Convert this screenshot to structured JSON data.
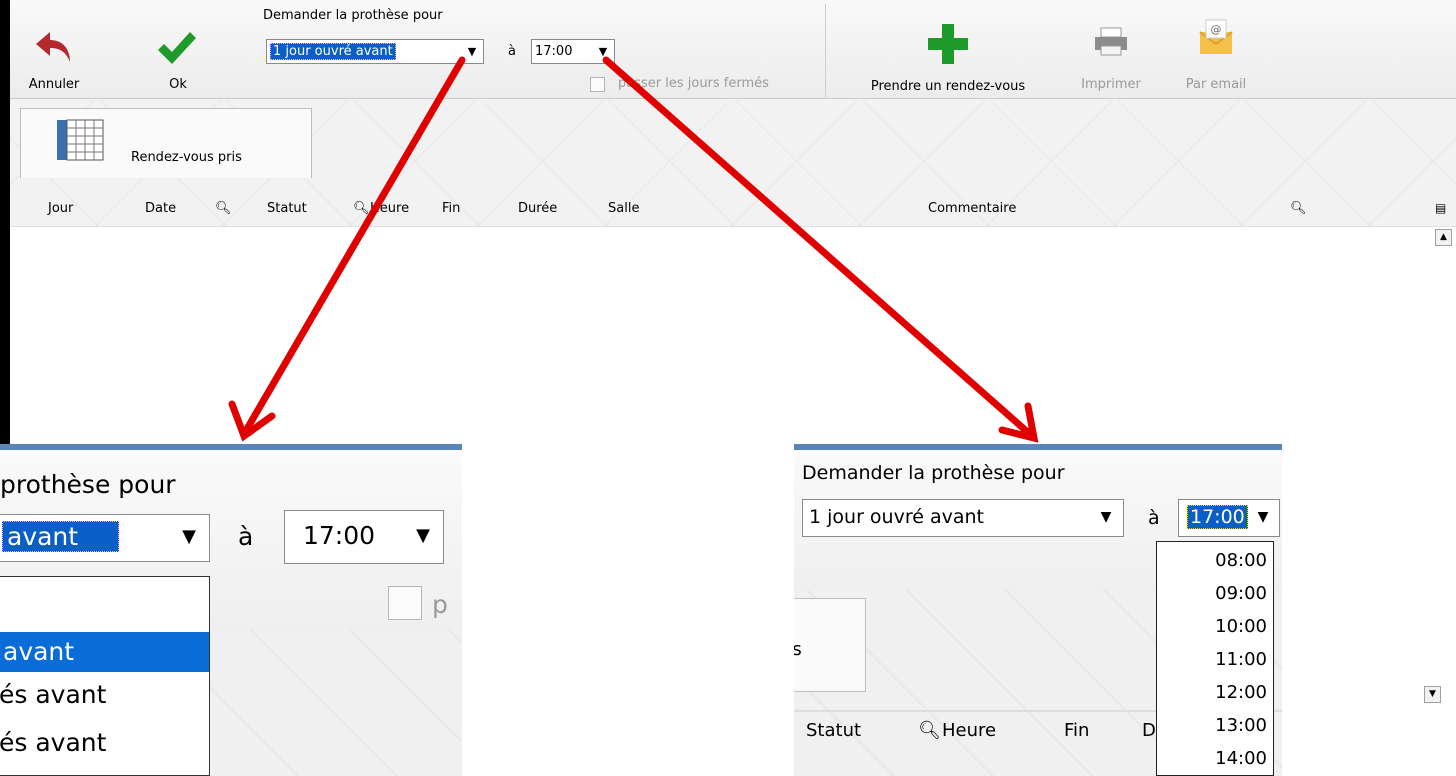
{
  "toolbar": {
    "cancel_label": "Annuler",
    "ok_label": "Ok",
    "request_label": "Demander la prothèse pour",
    "delay_value": "1 jour ouvré avant",
    "at_label": "à",
    "time_value": "17:00",
    "skip_closed_label": "passer les jours fermés",
    "appointment_label": "Prendre un rendez-vous",
    "print_label": "Imprimer",
    "email_label": "Par email"
  },
  "tab": {
    "label": "Rendez-vous pris"
  },
  "table": {
    "columns": [
      "Jour",
      "Date",
      "Statut",
      "Heure",
      "Fin",
      "Durée",
      "Salle",
      "Commentaire"
    ]
  },
  "zoom_left": {
    "heading": "prothèse pour",
    "combo_value": "avant",
    "at_label": "à",
    "time_value": "17:00",
    "skip_partial": "p",
    "options": [
      "",
      "avant",
      "és avant",
      "és avant"
    ],
    "selected_index": 1
  },
  "zoom_right": {
    "heading": "Demander la prothèse pour",
    "combo_value": "1 jour ouvré avant",
    "at_label": "à",
    "time_value": "17:00",
    "tab_partial": "ris",
    "col_statut": "Statut",
    "col_heure": "Heure",
    "col_fin": "Fin",
    "col_partial": "D",
    "time_options": [
      "08:00",
      "09:00",
      "10:00",
      "11:00",
      "12:00",
      "13:00",
      "14:00"
    ]
  },
  "colors": {
    "accent_arrow": "#e00000",
    "selection": "#0a6cd6",
    "ok_green": "#1d9a2a"
  }
}
